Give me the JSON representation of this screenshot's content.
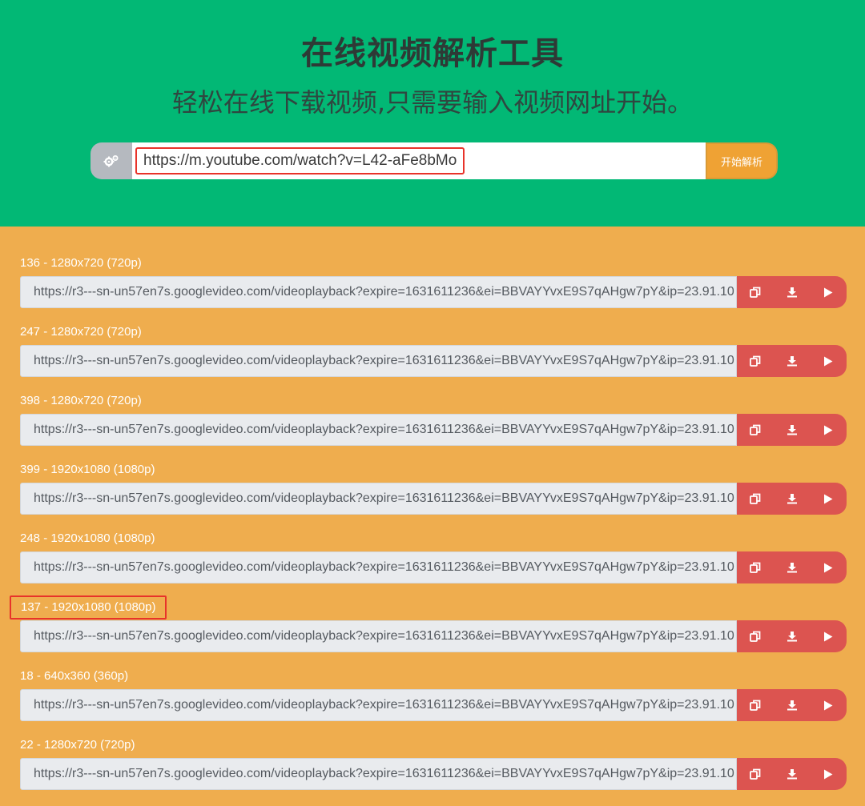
{
  "header": {
    "title": "在线视频解析工具",
    "subtitle": "轻松在线下载视频,只需要输入视频网址开始。"
  },
  "search": {
    "icon": "gears-icon",
    "value": "https://m.youtube.com/watch?v=L42-aFe8bMo",
    "button_label": "开始解析"
  },
  "results": [
    {
      "label": "136 - 1280x720 (720p)",
      "url": "https://r3---sn-un57en7s.googlevideo.com/videoplayback?expire=1631611236&ei=BBVAYYvxE9S7qAHgw7pY&ip=23.91.10"
    },
    {
      "label": "247 - 1280x720 (720p)",
      "url": "https://r3---sn-un57en7s.googlevideo.com/videoplayback?expire=1631611236&ei=BBVAYYvxE9S7qAHgw7pY&ip=23.91.10"
    },
    {
      "label": "398 - 1280x720 (720p)",
      "url": "https://r3---sn-un57en7s.googlevideo.com/videoplayback?expire=1631611236&ei=BBVAYYvxE9S7qAHgw7pY&ip=23.91.10"
    },
    {
      "label": "399 - 1920x1080 (1080p)",
      "url": "https://r3---sn-un57en7s.googlevideo.com/videoplayback?expire=1631611236&ei=BBVAYYvxE9S7qAHgw7pY&ip=23.91.10"
    },
    {
      "label": "248 - 1920x1080 (1080p)",
      "url": "https://r3---sn-un57en7s.googlevideo.com/videoplayback?expire=1631611236&ei=BBVAYYvxE9S7qAHgw7pY&ip=23.91.10"
    },
    {
      "label": "137 - 1920x1080 (1080p)",
      "url": "https://r3---sn-un57en7s.googlevideo.com/videoplayback?expire=1631611236&ei=BBVAYYvxE9S7qAHgw7pY&ip=23.91.10"
    },
    {
      "label": "18 - 640x360 (360p)",
      "url": "https://r3---sn-un57en7s.googlevideo.com/videoplayback?expire=1631611236&ei=BBVAYYvxE9S7qAHgw7pY&ip=23.91.10"
    },
    {
      "label": "22 - 1280x720 (720p)",
      "url": "https://r3---sn-un57en7s.googlevideo.com/videoplayback?expire=1631611236&ei=BBVAYYvxE9S7qAHgw7pY&ip=23.91.10"
    }
  ],
  "row_actions": [
    {
      "name": "copy",
      "icon": "copy-icon"
    },
    {
      "name": "download",
      "icon": "download-icon"
    },
    {
      "name": "play",
      "icon": "play-icon"
    }
  ],
  "colors": {
    "header_bg": "#02b875",
    "body_bg": "#efad4e",
    "button_orange": "#efa234",
    "action_red": "#dc5450",
    "highlight_red": "#e8332a"
  }
}
